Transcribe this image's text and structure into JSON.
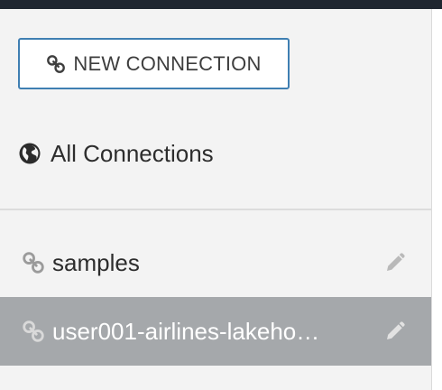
{
  "new_connection_button": {
    "label": "NEW CONNECTION",
    "icon": "link-icon"
  },
  "all_connections": {
    "label": "All Connections",
    "icon": "globe-icon"
  },
  "connections": [
    {
      "name": "samples",
      "icon": "link-icon",
      "edit_icon": "pencil-icon",
      "selected": false
    },
    {
      "name": "user001-airlines-lakeho…",
      "icon": "link-icon",
      "edit_icon": "pencil-icon",
      "selected": true
    }
  ],
  "colors": {
    "topbar": "#1f2630",
    "panel_bg": "#f3f3f3",
    "button_border": "#3f7fb2",
    "selected_row_bg": "#a5a8ab"
  }
}
